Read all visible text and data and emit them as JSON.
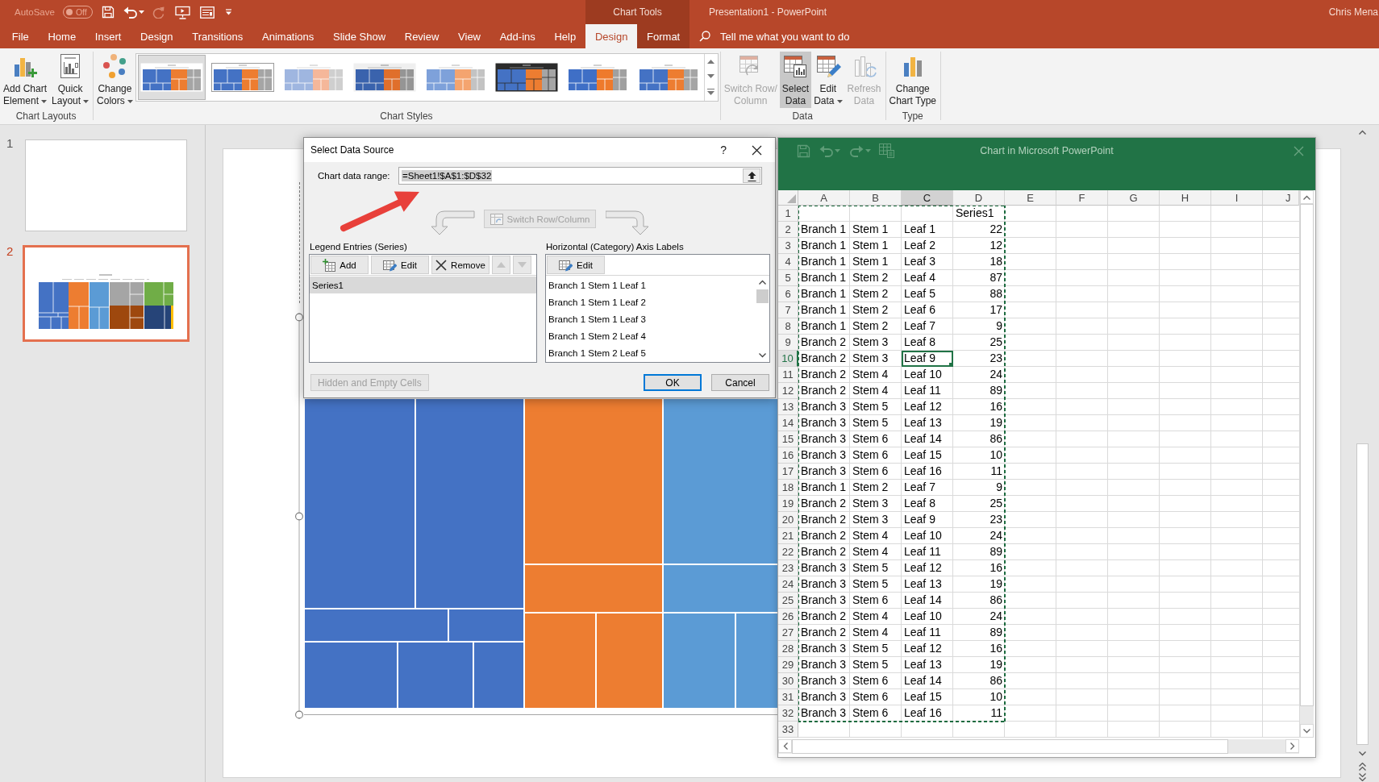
{
  "title_bar": {
    "autosave": {
      "label": "AutoSave",
      "state": "Off",
      "on": false
    },
    "quick_access": [
      {
        "kind": "save",
        "disabled": false
      },
      {
        "kind": "undo",
        "disabled": false
      },
      {
        "kind": "redo",
        "disabled": true
      },
      {
        "kind": "present",
        "disabled": false
      },
      {
        "kind": "touch",
        "disabled": false
      },
      {
        "kind": "customize",
        "disabled": false
      }
    ],
    "context_group": "Chart Tools",
    "document_title": "Presentation1 - PowerPoint",
    "user": "Chris Mena"
  },
  "tabs": [
    {
      "label": "File",
      "selected": false,
      "contextual": false
    },
    {
      "label": "Home",
      "selected": false,
      "contextual": false
    },
    {
      "label": "Insert",
      "selected": false,
      "contextual": false
    },
    {
      "label": "Design",
      "selected": false,
      "contextual": false
    },
    {
      "label": "Transitions",
      "selected": false,
      "contextual": false
    },
    {
      "label": "Animations",
      "selected": false,
      "contextual": false
    },
    {
      "label": "Slide Show",
      "selected": false,
      "contextual": false
    },
    {
      "label": "Review",
      "selected": false,
      "contextual": false
    },
    {
      "label": "View",
      "selected": false,
      "contextual": false
    },
    {
      "label": "Add-ins",
      "selected": false,
      "contextual": false
    },
    {
      "label": "Help",
      "selected": false,
      "contextual": false
    },
    {
      "label": "Design",
      "selected": true,
      "contextual": true
    },
    {
      "label": "Format",
      "selected": false,
      "contextual": true
    }
  ],
  "tell_me": {
    "placeholder": "Tell me what you want to do"
  },
  "ribbon": {
    "groups": [
      {
        "label": "Chart Layouts",
        "commands": [
          {
            "kind": "element",
            "lines": [
              "Add Chart",
              "Element"
            ],
            "dropdown": true,
            "disabled": false,
            "pressed": false
          },
          {
            "kind": "layout",
            "lines": [
              "Quick",
              "Layout"
            ],
            "dropdown": true,
            "disabled": false,
            "pressed": false
          }
        ]
      },
      {
        "label": "Chart Styles",
        "commands": [
          {
            "kind": "colors",
            "lines": [
              "Change",
              "Colors"
            ],
            "dropdown": true,
            "disabled": false,
            "pressed": false
          }
        ],
        "styles": [
          {
            "kind": "plain",
            "selected": true
          },
          {
            "kind": "outlined",
            "selected": false
          },
          {
            "kind": "pale",
            "selected": false
          },
          {
            "kind": "shaded",
            "selected": false
          },
          {
            "kind": "soft",
            "selected": false
          },
          {
            "kind": "dark",
            "selected": false
          },
          {
            "kind": "bold",
            "selected": false
          },
          {
            "kind": "plain",
            "selected": false
          }
        ]
      },
      {
        "label": "Data",
        "commands": [
          {
            "kind": "switch",
            "lines": [
              "Switch Row/",
              "Column"
            ],
            "dropdown": false,
            "disabled": true,
            "pressed": false
          },
          {
            "kind": "select",
            "lines": [
              "Select",
              "Data"
            ],
            "dropdown": false,
            "disabled": false,
            "pressed": true
          },
          {
            "kind": "edit",
            "lines": [
              "Edit",
              "Data"
            ],
            "dropdown": true,
            "disabled": false,
            "pressed": false
          },
          {
            "kind": "refresh",
            "lines": [
              "Refresh",
              "Data"
            ],
            "dropdown": false,
            "disabled": true,
            "pressed": false
          }
        ]
      },
      {
        "label": "Type",
        "commands": [
          {
            "kind": "charttype",
            "lines": [
              "Change",
              "Chart Type"
            ],
            "dropdown": false,
            "disabled": false,
            "pressed": false
          }
        ]
      }
    ]
  },
  "slides": [
    {
      "number": "1",
      "kind": "blank",
      "selected": false
    },
    {
      "number": "2",
      "kind": "treemap",
      "selected": true
    }
  ],
  "slide_chart": {
    "selected": true
  },
  "dialog": {
    "title": "Select Data Source",
    "help": "?",
    "data_range": {
      "label": "Chart data range:",
      "value": "=Sheet1!$A$1:$D$32",
      "selected": true
    },
    "switch_button": {
      "label": "Switch Row/Column",
      "disabled": true
    },
    "legend": {
      "label": "Legend Entries (Series)",
      "buttons": [
        {
          "kind": "add",
          "label": "Add",
          "disabled": false
        },
        {
          "kind": "edit",
          "label": "Edit",
          "disabled": false
        },
        {
          "kind": "remove",
          "label": "Remove",
          "disabled": false
        },
        {
          "kind": "up",
          "disabled": true
        },
        {
          "kind": "down",
          "disabled": true
        }
      ],
      "items": [
        {
          "label": "Series1",
          "selected": true
        }
      ]
    },
    "axis": {
      "label": "Horizontal (Category) Axis Labels",
      "buttons": [
        {
          "kind": "edit",
          "label": "Edit",
          "disabled": false
        }
      ],
      "items": [
        {
          "label": "Branch 1 Stem 1 Leaf 1",
          "selected": false
        },
        {
          "label": "Branch 1 Stem 1 Leaf 2",
          "selected": false
        },
        {
          "label": "Branch 1 Stem 1 Leaf 3",
          "selected": false
        },
        {
          "label": "Branch 1 Stem 2 Leaf 4",
          "selected": false
        },
        {
          "label": "Branch 1 Stem 2 Leaf 5",
          "selected": false
        }
      ]
    },
    "footer_buttons": [
      {
        "kind": "hidden",
        "label": "Hidden and Empty Cells",
        "disabled": true,
        "default": false
      },
      {
        "kind": "ok",
        "label": "OK",
        "disabled": false,
        "default": true
      },
      {
        "kind": "cancel",
        "label": "Cancel",
        "disabled": false,
        "default": false
      }
    ]
  },
  "chart_sheet": {
    "title": "Chart in Microsoft PowerPoint",
    "columns": [
      {
        "label": "A",
        "selected": false
      },
      {
        "label": "B",
        "selected": false
      },
      {
        "label": "C",
        "selected": true
      },
      {
        "label": "D",
        "selected": false
      },
      {
        "label": "E",
        "selected": false
      },
      {
        "label": "F",
        "selected": false
      },
      {
        "label": "G",
        "selected": false
      },
      {
        "label": "H",
        "selected": false
      },
      {
        "label": "I",
        "selected": false
      },
      {
        "label": "J",
        "selected": false
      }
    ],
    "rows": [
      {
        "number": "1",
        "selected": false,
        "series_name": "Series1"
      },
      {
        "number": "2",
        "selected": false,
        "labels": [
          "Branch 1",
          "Stem 1",
          "Leaf 1"
        ],
        "value": "22"
      },
      {
        "number": "3",
        "selected": false,
        "labels": [
          "Branch 1",
          "Stem 1",
          "Leaf 2"
        ],
        "value": "12"
      },
      {
        "number": "4",
        "selected": false,
        "labels": [
          "Branch 1",
          "Stem 1",
          "Leaf 3"
        ],
        "value": "18"
      },
      {
        "number": "5",
        "selected": false,
        "labels": [
          "Branch 1",
          "Stem 2",
          "Leaf 4"
        ],
        "value": "87"
      },
      {
        "number": "6",
        "selected": false,
        "labels": [
          "Branch 1",
          "Stem 2",
          "Leaf 5"
        ],
        "value": "88"
      },
      {
        "number": "7",
        "selected": false,
        "labels": [
          "Branch 1",
          "Stem 2",
          "Leaf 6"
        ],
        "value": "17"
      },
      {
        "number": "8",
        "selected": false,
        "labels": [
          "Branch 1",
          "Stem 2",
          "Leaf 7"
        ],
        "value": "9"
      },
      {
        "number": "9",
        "selected": false,
        "labels": [
          "Branch 2",
          "Stem 3",
          "Leaf 8"
        ],
        "value": "25"
      },
      {
        "number": "10",
        "selected": true,
        "labels": [
          "Branch 2",
          "Stem 3",
          "Leaf 9"
        ],
        "value": "23"
      },
      {
        "number": "11",
        "selected": false,
        "labels": [
          "Branch 2",
          "Stem 4",
          "Leaf 10"
        ],
        "value": "24"
      },
      {
        "number": "12",
        "selected": false,
        "labels": [
          "Branch 2",
          "Stem 4",
          "Leaf 11"
        ],
        "value": "89"
      },
      {
        "number": "13",
        "selected": false,
        "labels": [
          "Branch 3",
          "Stem 5",
          "Leaf 12"
        ],
        "value": "16"
      },
      {
        "number": "14",
        "selected": false,
        "labels": [
          "Branch 3",
          "Stem 5",
          "Leaf 13"
        ],
        "value": "19"
      },
      {
        "number": "15",
        "selected": false,
        "labels": [
          "Branch 3",
          "Stem 6",
          "Leaf 14"
        ],
        "value": "86"
      },
      {
        "number": "16",
        "selected": false,
        "labels": [
          "Branch 3",
          "Stem 6",
          "Leaf 15"
        ],
        "value": "10"
      },
      {
        "number": "17",
        "selected": false,
        "labels": [
          "Branch 3",
          "Stem 6",
          "Leaf 16"
        ],
        "value": "11"
      },
      {
        "number": "18",
        "selected": false,
        "labels": [
          "Branch 1",
          "Stem 2",
          "Leaf 7"
        ],
        "value": "9"
      },
      {
        "number": "19",
        "selected": false,
        "labels": [
          "Branch 2",
          "Stem 3",
          "Leaf 8"
        ],
        "value": "25"
      },
      {
        "number": "20",
        "selected": false,
        "labels": [
          "Branch 2",
          "Stem 3",
          "Leaf 9"
        ],
        "value": "23"
      },
      {
        "number": "21",
        "selected": false,
        "labels": [
          "Branch 2",
          "Stem 4",
          "Leaf 10"
        ],
        "value": "24"
      },
      {
        "number": "22",
        "selected": false,
        "labels": [
          "Branch 2",
          "Stem 4",
          "Leaf 11"
        ],
        "value": "89"
      },
      {
        "number": "23",
        "selected": false,
        "labels": [
          "Branch 3",
          "Stem 5",
          "Leaf 12"
        ],
        "value": "16"
      },
      {
        "number": "24",
        "selected": false,
        "labels": [
          "Branch 3",
          "Stem 5",
          "Leaf 13"
        ],
        "value": "19"
      },
      {
        "number": "25",
        "selected": false,
        "labels": [
          "Branch 3",
          "Stem 6",
          "Leaf 14"
        ],
        "value": "86"
      },
      {
        "number": "26",
        "selected": false,
        "labels": [
          "Branch 2",
          "Stem 4",
          "Leaf 10"
        ],
        "value": "24"
      },
      {
        "number": "27",
        "selected": false,
        "labels": [
          "Branch 2",
          "Stem 4",
          "Leaf 11"
        ],
        "value": "89"
      },
      {
        "number": "28",
        "selected": false,
        "labels": [
          "Branch 3",
          "Stem 5",
          "Leaf 12"
        ],
        "value": "16"
      },
      {
        "number": "29",
        "selected": false,
        "labels": [
          "Branch 3",
          "Stem 5",
          "Leaf 13"
        ],
        "value": "19"
      },
      {
        "number": "30",
        "selected": false,
        "labels": [
          "Branch 3",
          "Stem 6",
          "Leaf 14"
        ],
        "value": "86"
      },
      {
        "number": "31",
        "selected": false,
        "labels": [
          "Branch 3",
          "Stem 6",
          "Leaf 15"
        ],
        "value": "10"
      },
      {
        "number": "32",
        "selected": false,
        "labels": [
          "Branch 3",
          "Stem 6",
          "Leaf 16"
        ],
        "value": "11"
      },
      {
        "number": "33",
        "selected": false
      }
    ],
    "range_marked": true
  }
}
